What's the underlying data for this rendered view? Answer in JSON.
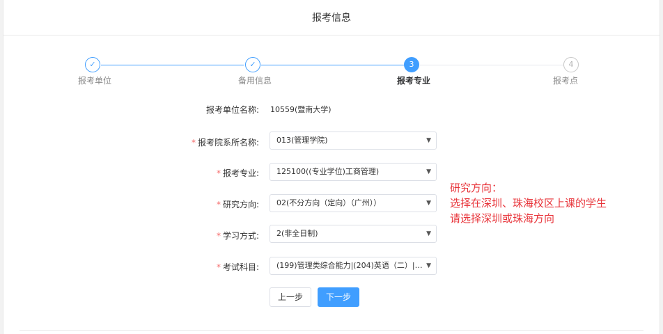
{
  "header": {
    "title": "报考信息"
  },
  "steps": [
    {
      "label": "报考单位",
      "marker": "✓",
      "state": "done"
    },
    {
      "label": "备用信息",
      "marker": "✓",
      "state": "done"
    },
    {
      "label": "报考专业",
      "marker": "3",
      "state": "active"
    },
    {
      "label": "报考点",
      "marker": "4",
      "state": "todo"
    }
  ],
  "form": {
    "unit": {
      "label": "报考单位名称:",
      "value": "10559(暨南大学)"
    },
    "department": {
      "label": "报考院系所名称:",
      "value": "013(管理学院)"
    },
    "major": {
      "label": "报考专业:",
      "value": "125100((专业学位)工商管理)"
    },
    "direction": {
      "label": "研究方向:",
      "value": "02(不分方向（定向）（广州））"
    },
    "study_mode": {
      "label": "学习方式:",
      "value": "2(非全日制)"
    },
    "subjects": {
      "label": "考试科目:",
      "value": "(199)管理类综合能力|(204)英语（二）|(-..."
    },
    "required_mark": "*"
  },
  "annotation": {
    "line1": "研究方向：",
    "line2": "选择在深圳、珠海校区上课的学生",
    "line3": "请选择深圳或珠海方向"
  },
  "buttons": {
    "prev": "上一步",
    "next": "下一步"
  },
  "colors": {
    "accent": "#409eff",
    "annotation": "#e8343a",
    "required": "#f56c6c"
  }
}
